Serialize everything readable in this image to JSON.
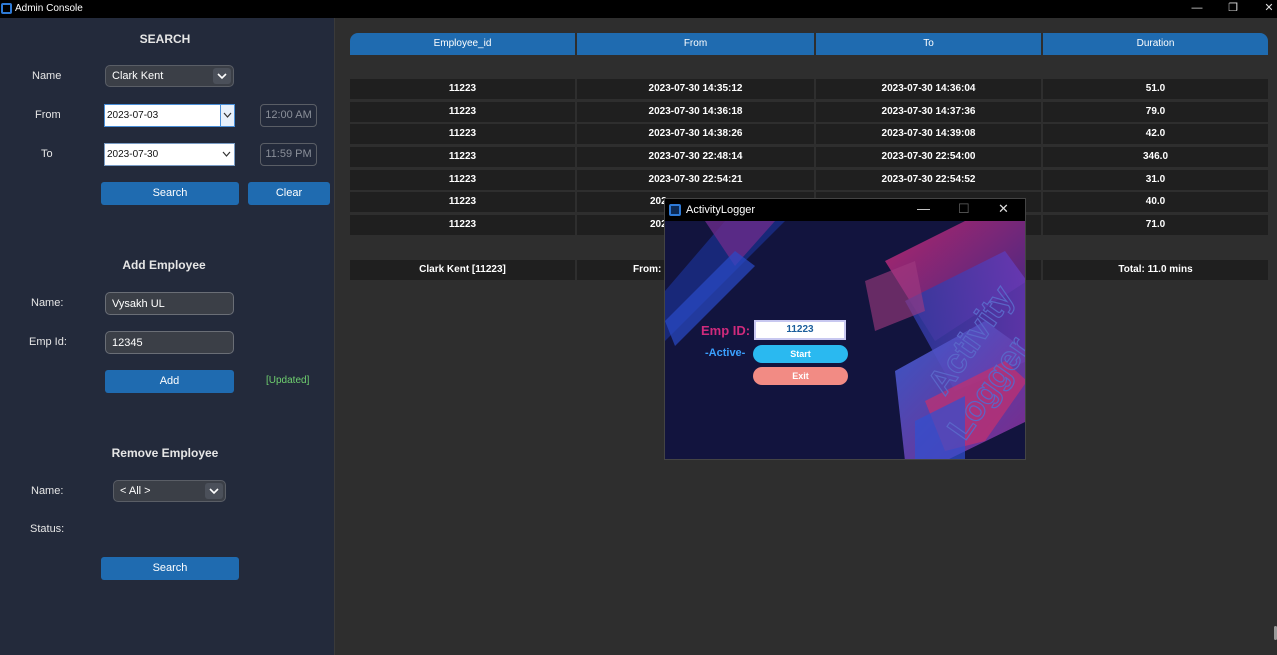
{
  "window": {
    "title": "Admin Console",
    "minimize": "—",
    "restore": "❐",
    "close": "✕"
  },
  "search": {
    "heading": "SEARCH",
    "name_label": "Name",
    "name_value": "Clark Kent",
    "from_label": "From",
    "from_date": "2023-07-03",
    "from_time": "12:00 AM",
    "to_label": "To",
    "to_date": "2023-07-30",
    "to_time": "11:59 PM",
    "search_button": "Search",
    "clear_button": "Clear"
  },
  "add_employee": {
    "heading": "Add Employee",
    "name_label": "Name:",
    "name_value": "Vysakh UL",
    "empid_label": "Emp Id:",
    "empid_value": "12345",
    "add_button": "Add",
    "status": "[Updated]"
  },
  "remove_employee": {
    "heading": "Remove Employee",
    "name_label": "Name:",
    "name_value": "< All >",
    "status_label": "Status:",
    "search_button": "Search"
  },
  "table": {
    "headers": [
      "Employee_id",
      "From",
      "To",
      "Duration"
    ],
    "rows": [
      [
        "11223",
        "2023-07-30 14:35:12",
        "2023-07-30 14:36:04",
        "51.0"
      ],
      [
        "11223",
        "2023-07-30 14:36:18",
        "2023-07-30 14:37:36",
        "79.0"
      ],
      [
        "11223",
        "2023-07-30 14:38:26",
        "2023-07-30 14:39:08",
        "42.0"
      ],
      [
        "11223",
        "2023-07-30 22:48:14",
        "2023-07-30 22:54:00",
        "346.0"
      ],
      [
        "11223",
        "2023-07-30 22:54:21",
        "2023-07-30 22:54:52",
        "31.0"
      ],
      [
        "11223",
        "202",
        "",
        "40.0"
      ],
      [
        "11223",
        "202",
        "",
        "71.0"
      ]
    ],
    "summary": [
      "Clark Kent [11223]",
      "From: 2",
      "",
      "Total: 11.0 mins"
    ]
  },
  "popup": {
    "title": "ActivityLogger",
    "minimize": "—",
    "maximize": "☐",
    "close": "✕",
    "emp_label": "Emp ID:",
    "emp_value": "11223",
    "active_label": "-Active-",
    "start_button": "Start",
    "exit_button": "Exit",
    "watermark_1": "Activity",
    "watermark_2": "Logger"
  },
  "colors": {
    "sidebar_bg": "#232a3b",
    "main_bg": "#2e2e2e",
    "accent": "#1f6bb0",
    "updated_green": "#6fd06f"
  }
}
